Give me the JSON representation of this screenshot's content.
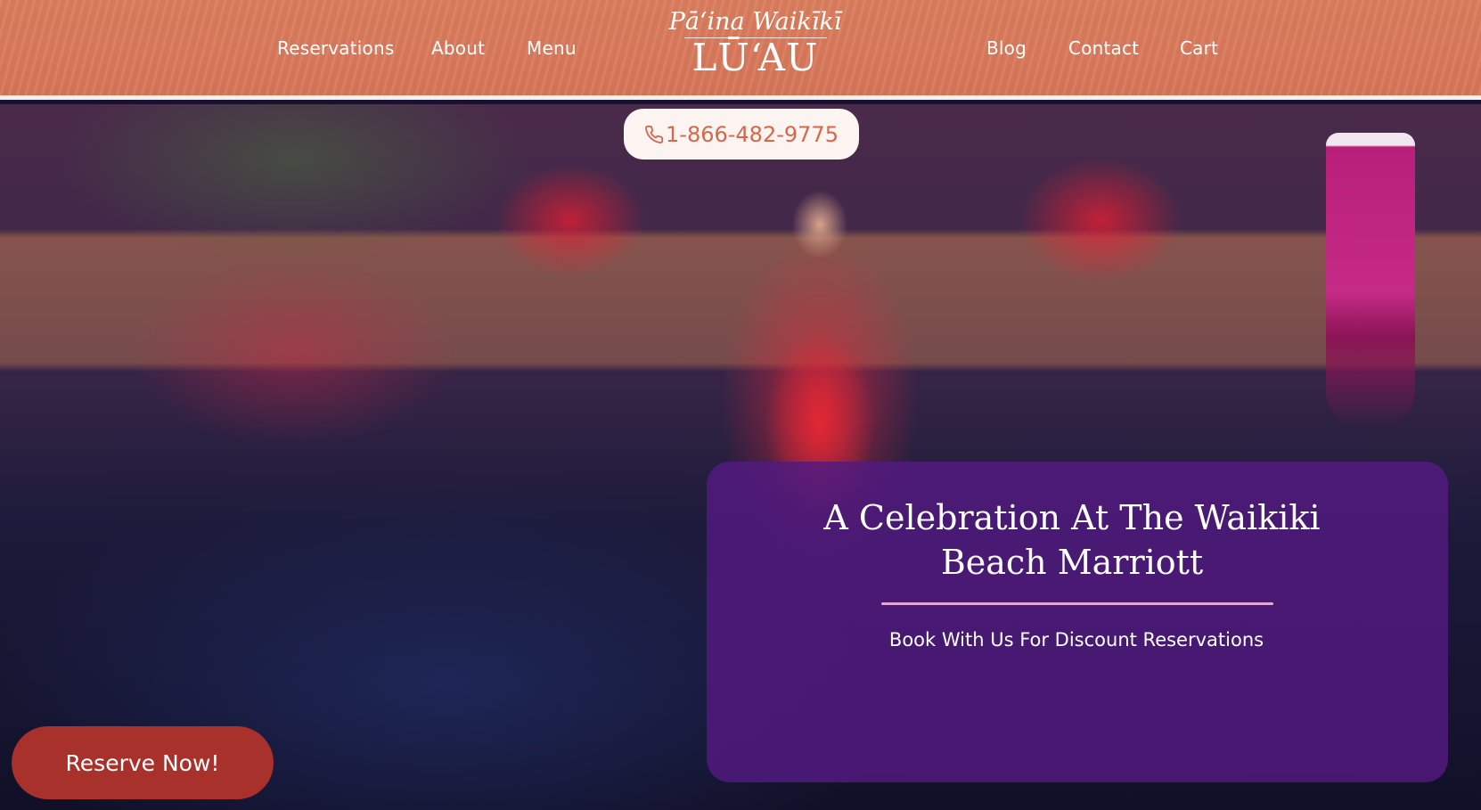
{
  "header": {
    "nav_left": [
      "Reservations",
      "About",
      "Menu"
    ],
    "nav_right": [
      "Blog",
      "Contact",
      "Cart"
    ],
    "logo": {
      "top_text": "Pāʻina Waikīkī",
      "main_text": "LŪʻAU"
    }
  },
  "hero": {
    "phone": {
      "icon": "phone-icon",
      "number": "1-866-482-9775"
    },
    "promo": {
      "title": "A Celebration At The Waikiki Beach Marriott",
      "subtitle": "Book With Us For Discount Reservations"
    },
    "reserve_button": "Reserve Now!"
  },
  "colors": {
    "header_bg": "#d8765a",
    "promo_card": "#521a80",
    "promo_divider": "#e4a7dc",
    "phone_text": "#d2694d",
    "reserve_button": "#a8312b"
  }
}
